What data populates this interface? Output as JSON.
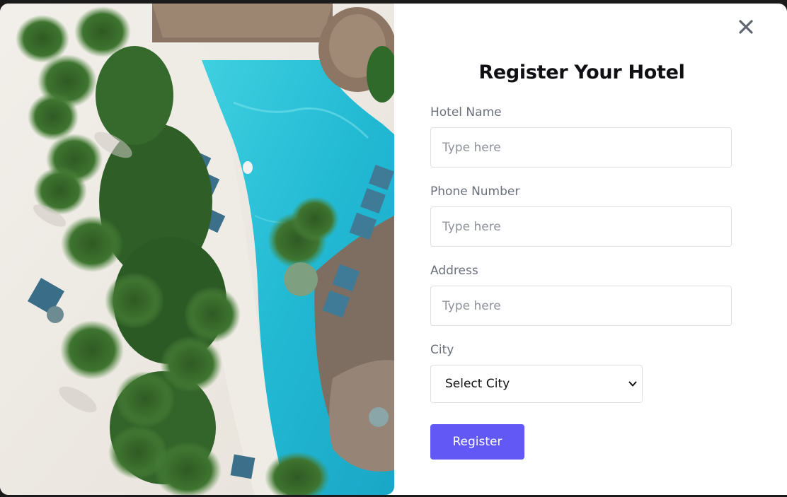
{
  "modal": {
    "title": "Register Your Hotel",
    "close_icon": "close-icon",
    "image_alt_subject": "aerial resort pool with palm trees and beach"
  },
  "form": {
    "fields": [
      {
        "label": "Hotel Name",
        "placeholder": "Type here",
        "value": ""
      },
      {
        "label": "Phone Number",
        "placeholder": "Type here",
        "value": ""
      },
      {
        "label": "Address",
        "placeholder": "Type here",
        "value": ""
      }
    ],
    "city": {
      "label": "City",
      "selected": "Select City",
      "chevron_icon": "chevron-down-icon"
    },
    "submit_label": "Register"
  },
  "colors": {
    "accent": "#6158f5",
    "label": "#6a6f7b",
    "title": "#0f0f14",
    "border": "#dcdfe4"
  }
}
